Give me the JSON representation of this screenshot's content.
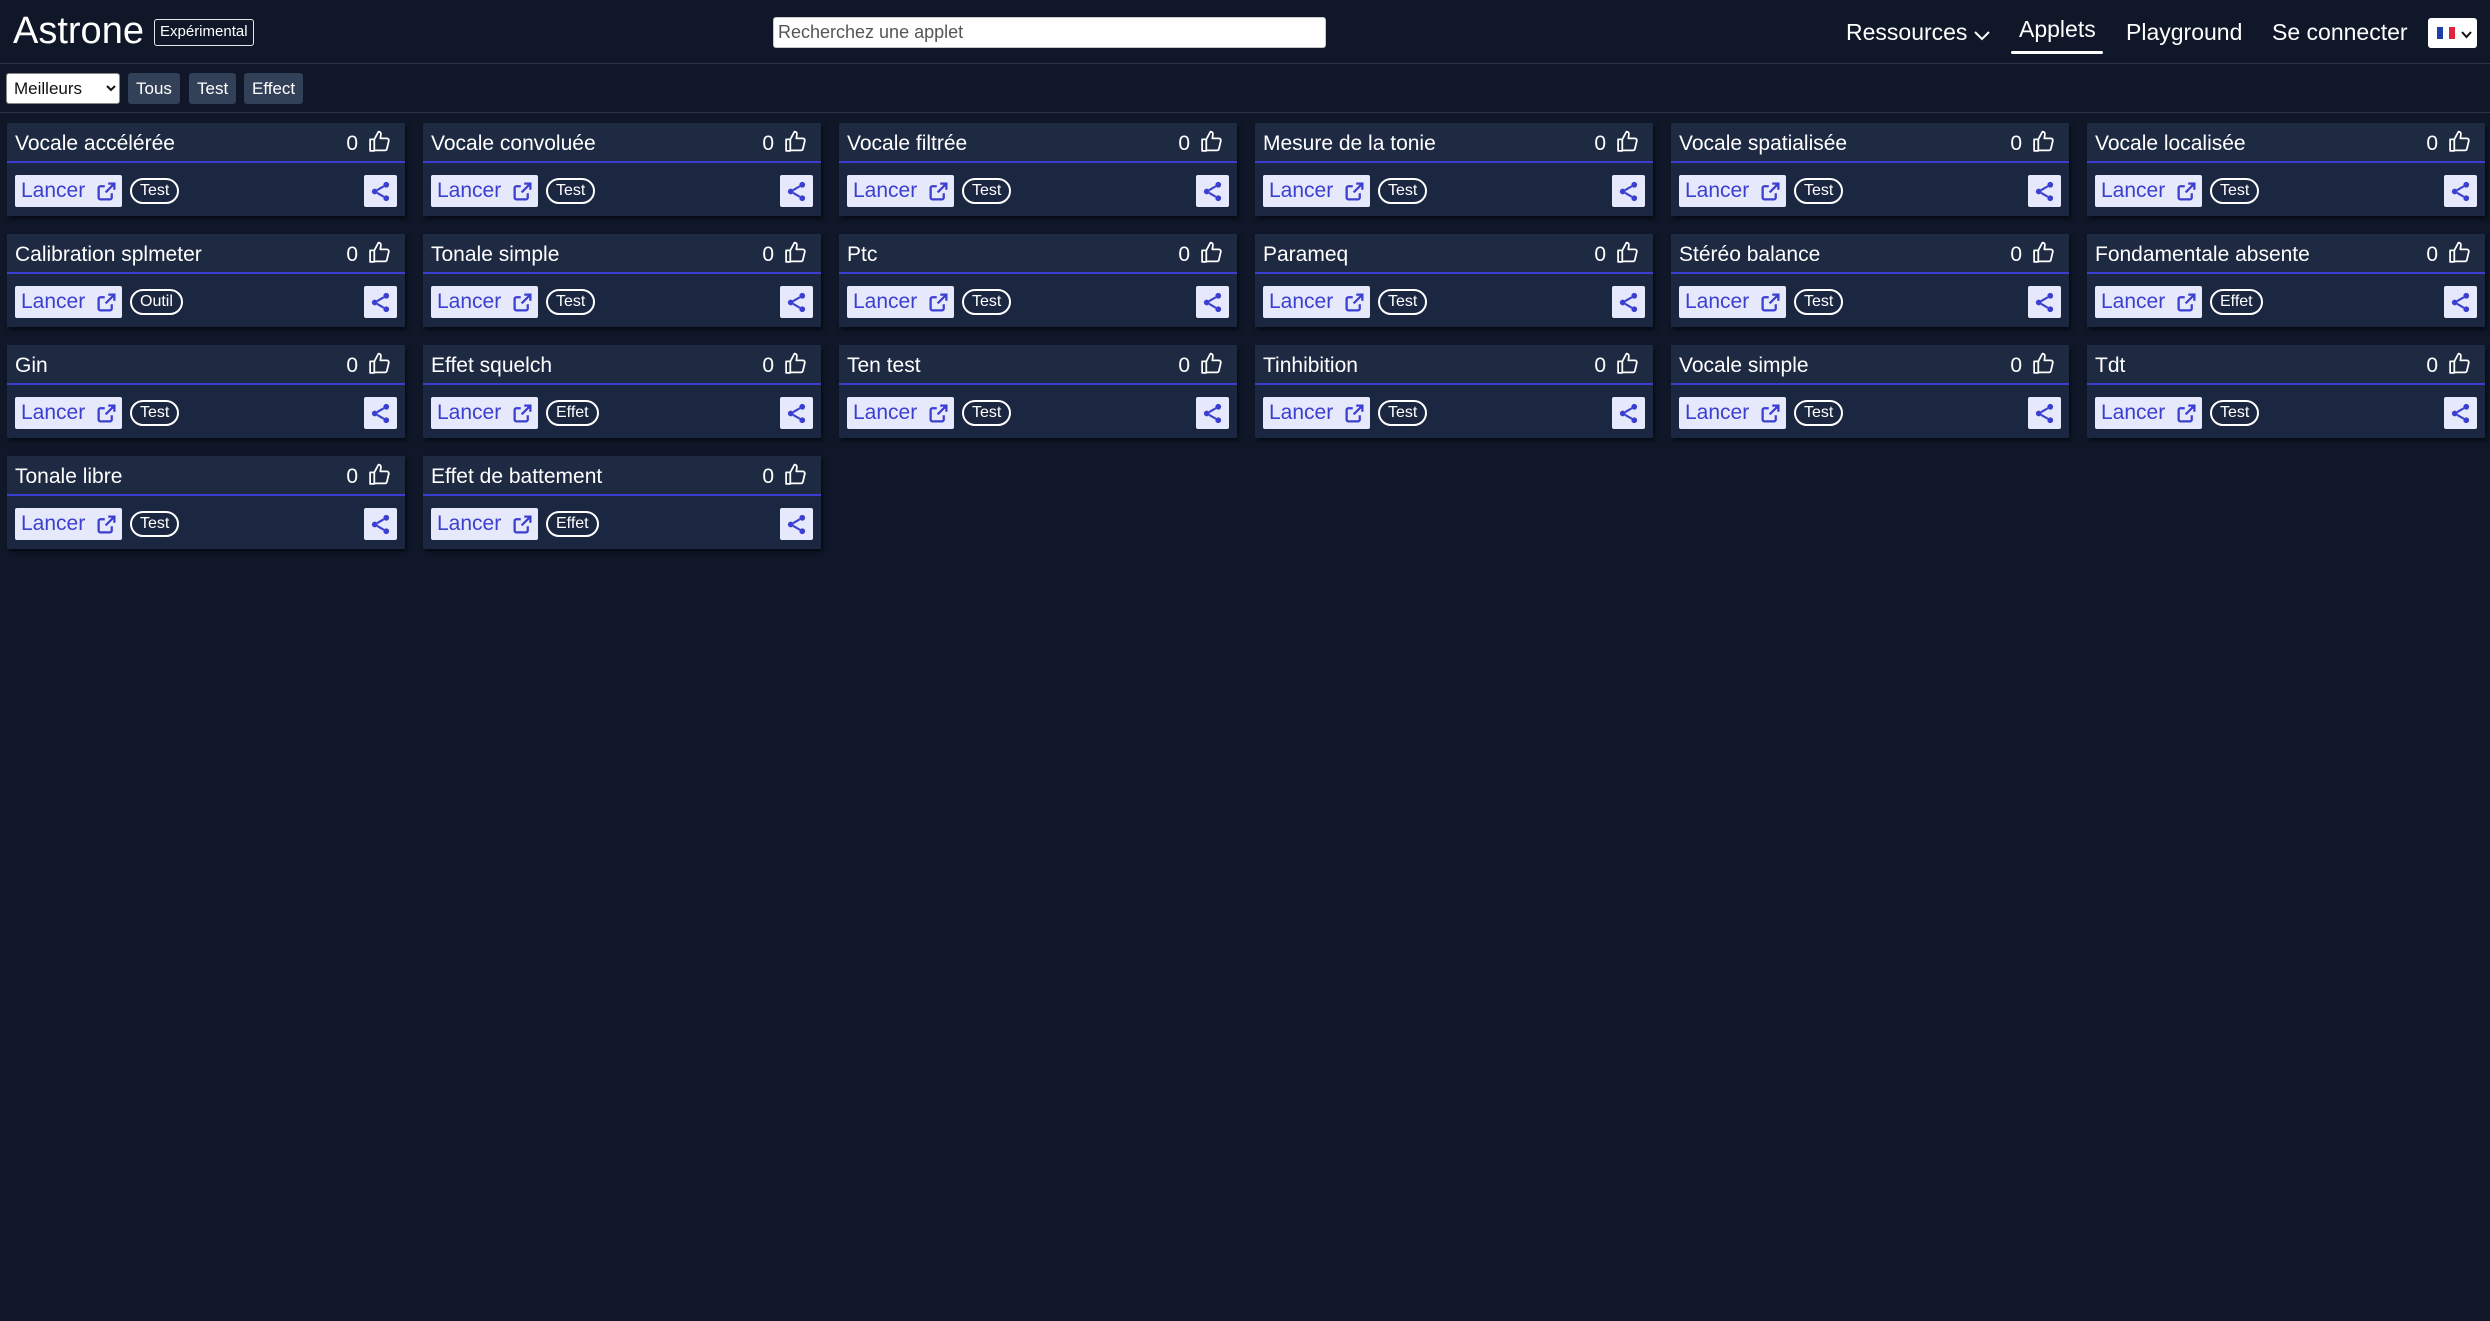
{
  "header": {
    "brand": "Astrone",
    "badge": "Expérimental",
    "search_placeholder": "Recherchez une applet",
    "nav": {
      "resources": "Ressources",
      "applets": "Applets",
      "playground": "Playground",
      "login": "Se connecter"
    },
    "language_flag": "fr-flag-icon"
  },
  "filters": {
    "sort_selected": "Meilleurs",
    "chips": [
      {
        "label": "Tous",
        "active": true
      },
      {
        "label": "Test",
        "active": false
      },
      {
        "label": "Effect",
        "active": false
      }
    ]
  },
  "launch_label": "Lancer",
  "colors": {
    "background": "#0f1729",
    "card": "#1b2640",
    "accent": "#3b3fcf",
    "button_bg": "#e6e8fb"
  },
  "cards": [
    {
      "title": "Vocale accélérée",
      "likes": "0",
      "tag": "Test"
    },
    {
      "title": "Vocale convoluée",
      "likes": "0",
      "tag": "Test"
    },
    {
      "title": "Vocale filtrée",
      "likes": "0",
      "tag": "Test"
    },
    {
      "title": "Mesure de la tonie",
      "likes": "0",
      "tag": "Test"
    },
    {
      "title": "Vocale spatialisée",
      "likes": "0",
      "tag": "Test"
    },
    {
      "title": "Vocale localisée",
      "likes": "0",
      "tag": "Test"
    },
    {
      "title": "Calibration splmeter",
      "likes": "0",
      "tag": "Outil"
    },
    {
      "title": "Tonale simple",
      "likes": "0",
      "tag": "Test"
    },
    {
      "title": "Ptc",
      "likes": "0",
      "tag": "Test"
    },
    {
      "title": "Parameq",
      "likes": "0",
      "tag": "Test"
    },
    {
      "title": "Stéréo balance",
      "likes": "0",
      "tag": "Test"
    },
    {
      "title": "Fondamentale absente",
      "likes": "0",
      "tag": "Effet"
    },
    {
      "title": "Gin",
      "likes": "0",
      "tag": "Test"
    },
    {
      "title": "Effet squelch",
      "likes": "0",
      "tag": "Effet"
    },
    {
      "title": "Ten test",
      "likes": "0",
      "tag": "Test"
    },
    {
      "title": "Tinhibition",
      "likes": "0",
      "tag": "Test"
    },
    {
      "title": "Vocale simple",
      "likes": "0",
      "tag": "Test"
    },
    {
      "title": "Tdt",
      "likes": "0",
      "tag": "Test"
    },
    {
      "title": "Tonale libre",
      "likes": "0",
      "tag": "Test"
    },
    {
      "title": "Effet de battement",
      "likes": "0",
      "tag": "Effet"
    }
  ]
}
